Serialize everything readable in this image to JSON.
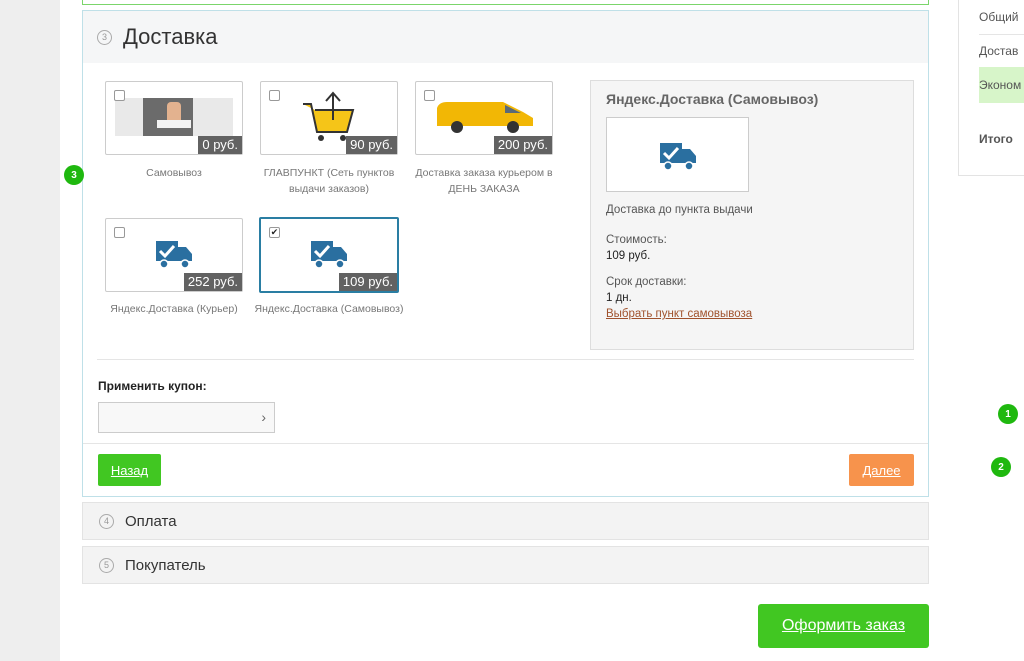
{
  "delivery": {
    "step": "3",
    "title": "Доставка",
    "options": [
      {
        "label": "Самовывоз",
        "price": "0 руб.",
        "checked": ""
      },
      {
        "label": "ГЛАВПУНКТ (Сеть пунктов выдачи заказов)",
        "price": "90 руб.",
        "checked": ""
      },
      {
        "label": "Доставка заказа курьером в ДЕНЬ ЗАКАЗА",
        "price": "200 руб.",
        "checked": ""
      },
      {
        "label": "Яндекс.Доставка (Курьер)",
        "price": "252 руб.",
        "checked": ""
      },
      {
        "label": "Яндекс.Доставка (Самовывоз)",
        "price": "109 руб.",
        "checked": "✔"
      }
    ],
    "info": {
      "title": "Яндекс.Доставка (Самовывоз)",
      "description": "Доставка до пункта выдачи",
      "cost_label": "Стоимость:",
      "cost_value": "109 руб.",
      "term_label": "Срок доставки:",
      "term_value": "1 дн.",
      "pickup_link": "Выбрать пункт самовывоза"
    },
    "coupon_label": "Применить купон:",
    "coupon_value": "",
    "back_label": "Назад",
    "next_label": "Далее"
  },
  "payment": {
    "step": "4",
    "title": "Оплата"
  },
  "buyer": {
    "step": "5",
    "title": "Покупатель"
  },
  "order_button": "Оформить заказ",
  "badges": {
    "b3": "3",
    "b1": "1",
    "b2": "2"
  },
  "side": {
    "row1": "Общий",
    "row2": "Достав",
    "row3": "Эконом",
    "total": "Итого"
  },
  "colors": {
    "green": "#41c722",
    "orange": "#f7934c",
    "truck_blue": "#2a6fa0",
    "selected_border": "#2a7ea3"
  }
}
